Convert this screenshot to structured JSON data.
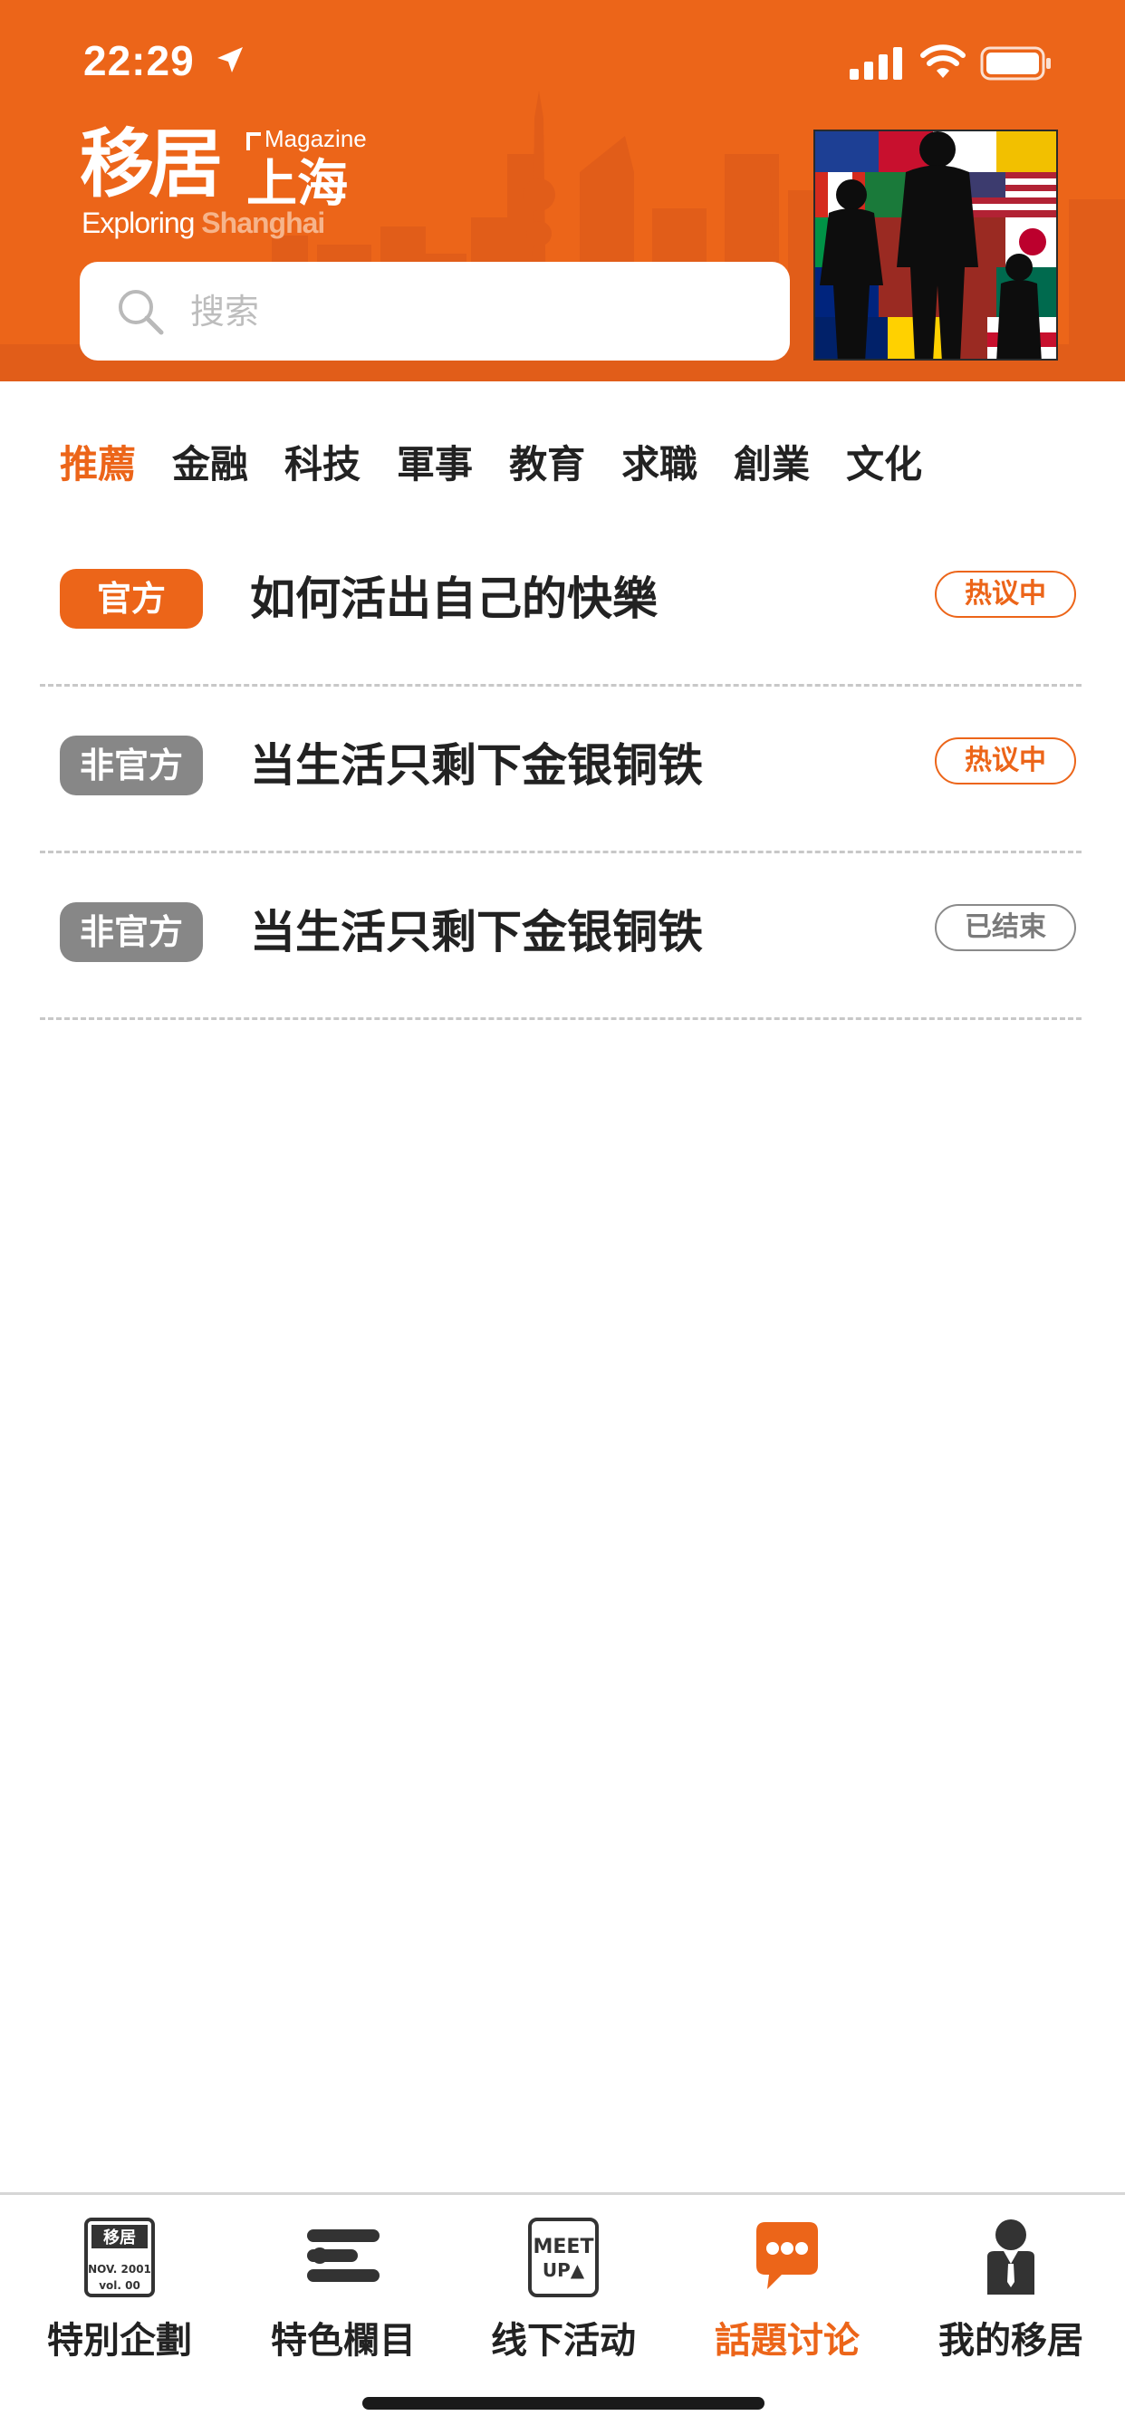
{
  "status_bar": {
    "time": "22:29",
    "location_icon": "location-arrow-icon",
    "signal_icon": "cellular-signal-icon",
    "wifi_icon": "wifi-icon",
    "battery_icon": "battery-icon"
  },
  "header": {
    "logo": {
      "cn_main": "移居",
      "cn_sub": "上海",
      "magazine": "Magazine",
      "en_prefix": "Exploring",
      "en_accent": "Shanghai"
    },
    "search": {
      "placeholder": "搜索",
      "value": "",
      "icon": "search-icon"
    },
    "accent_color": "#ec6519"
  },
  "categories": [
    "推薦",
    "金融",
    "科技",
    "軍事",
    "教育",
    "求職",
    "創業",
    "文化"
  ],
  "active_category": "推薦",
  "topics": [
    {
      "tag": "官方",
      "tag_type": "official",
      "title": "如何活出自己的快樂",
      "status": "热议中",
      "status_type": "hot"
    },
    {
      "tag": "非官方",
      "tag_type": "unofficial",
      "title": "当生活只剩下金银铜铁",
      "status": "热议中",
      "status_type": "hot"
    },
    {
      "tag": "非官方",
      "tag_type": "unofficial",
      "title": "当生活只剩下金银铜铁",
      "status": "已结束",
      "status_type": "ended"
    }
  ],
  "tabbar": {
    "items": [
      {
        "label": "特別企劃",
        "icon": "magazine-issue-icon",
        "issue_badge": "NOV. 2001",
        "issue_vol": "vol. 00"
      },
      {
        "label": "特色欄目",
        "icon": "column-list-icon"
      },
      {
        "label": "线下活动",
        "icon": "meetup-icon",
        "meet_text": "MEET",
        "up_text": "UP▲"
      },
      {
        "label": "話題讨论",
        "icon": "chat-bubble-icon"
      },
      {
        "label": "我的移居",
        "icon": "profile-person-icon"
      }
    ],
    "active_index": 3
  }
}
